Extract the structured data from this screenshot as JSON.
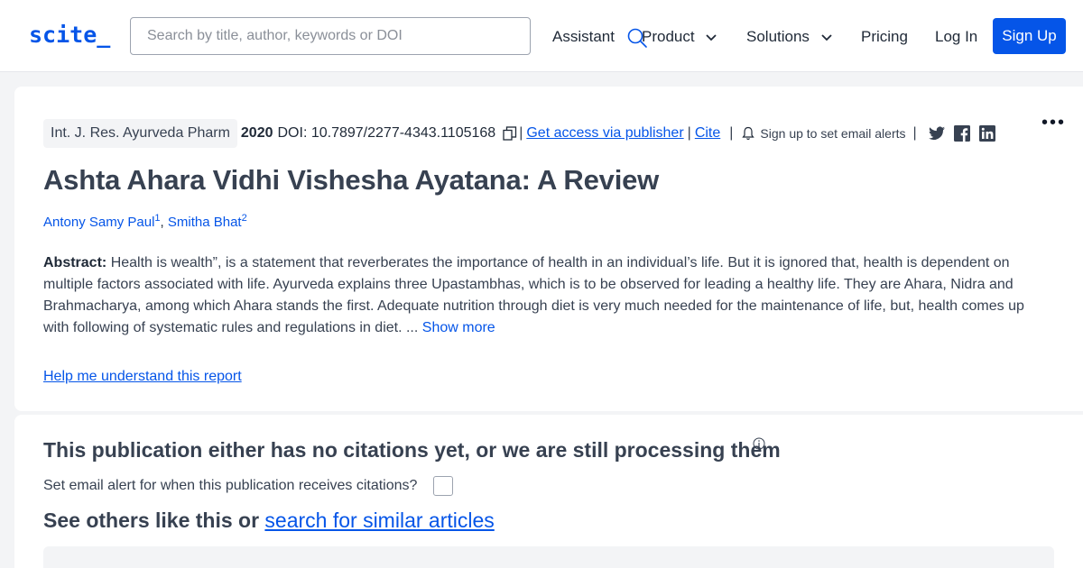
{
  "header": {
    "logo": "scite_",
    "search_placeholder": "Search by title, author, keywords or DOI",
    "nav": {
      "assistant": "Assistant",
      "product": "Product",
      "solutions": "Solutions",
      "pricing": "Pricing",
      "login": "Log In",
      "signup": "Sign Up"
    }
  },
  "paper": {
    "journal": "Int. J. Res. Ayurveda Pharm",
    "year": "2020",
    "doi": "DOI: 10.7897/2277-4343.1105168",
    "sep": "|",
    "get_access": "Get access via publisher",
    "cite": "Cite",
    "alerts": "Sign up to set email alerts",
    "title": "Ashta Ahara Vidhi Vishesha Ayatana: A Review",
    "authors": [
      {
        "name": "Antony Samy Paul",
        "sup": "1"
      },
      {
        "name": "Smitha Bhat",
        "sup": "2"
      }
    ],
    "author_sep": ",",
    "abstract_label": "Abstract:",
    "abstract_text": "Health is wealth”, is a statement that reverberates the importance of health in an individual’s life. But it is ignored that, health is dependent on multiple factors associated with life. Ayurveda explains three Upastambhas, which is to be observed for leading a healthy life. They are Ahara, Nidra and Brahmacharya, among which Ahara stands the first. Adequate nutrition through diet is very much needed for the maintenance of life, but, health comes up with following of systematic rules and regulations in diet. ...",
    "show_more": "Show more",
    "help_link": "Help me understand this report",
    "more_menu": "•••"
  },
  "citations": {
    "title": "This publication either has no citations yet, or we are still processing them",
    "email_question": "Set email alert for when this publication receives citations?",
    "others_prefix": "See others like this or",
    "others_link": "search for similar articles"
  },
  "colors": {
    "accent": "#0555e8",
    "text": "#374151",
    "background": "#f3f4f6"
  }
}
